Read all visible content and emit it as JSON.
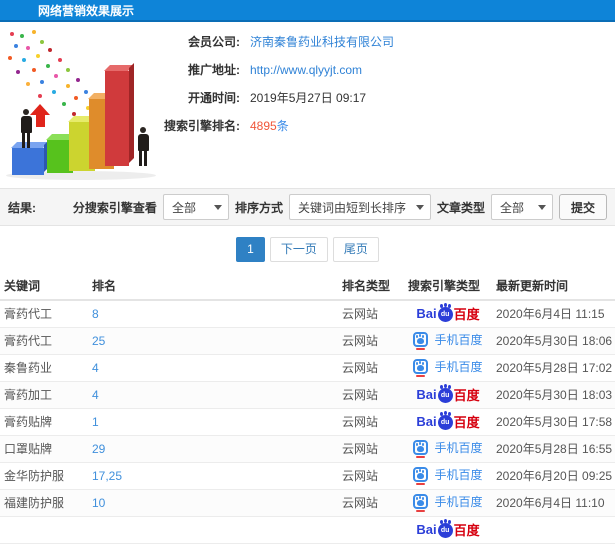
{
  "header": {
    "title": "网络营销效果展示"
  },
  "info": {
    "member_label": "会员公司:",
    "member_value": "济南秦鲁药业科技有限公司",
    "url_label": "推广地址:",
    "url_value": "http://www.qlyyjt.com",
    "open_label": "开通时间:",
    "open_value": "2019年5月27日 09:17",
    "rank_label": "搜索引擎排名:",
    "rank_value": "4895",
    "rank_suffix": "条"
  },
  "filters": {
    "result_label": "结果:",
    "engine_label": "分搜索引擎查看",
    "engine_value": "全部",
    "sort_label": "排序方式",
    "sort_value": "关键词由短到长排序",
    "article_label": "文章类型",
    "article_value": "全部",
    "submit_label": "提交"
  },
  "pagination": {
    "current": "1",
    "next": "下一页",
    "last": "尾页"
  },
  "table": {
    "headers": [
      "关键词",
      "排名",
      "排名类型",
      "搜索引擎类型",
      "最新更新时间"
    ],
    "logos": {
      "baidu_bai": "Bai",
      "baidu_du": "du",
      "baidu_cn": "百度",
      "mobile_label": "手机百度"
    },
    "rows": [
      {
        "keyword": "膏药代工",
        "rank": "8",
        "rank_type": "云网站",
        "engine": "baidu",
        "time": "2020年6月4日 11:15"
      },
      {
        "keyword": "膏药代工",
        "rank": "25",
        "rank_type": "云网站",
        "engine": "mobile",
        "time": "2020年5月30日 18:06"
      },
      {
        "keyword": "秦鲁药业",
        "rank": "4",
        "rank_type": "云网站",
        "engine": "mobile",
        "time": "2020年5月28日 17:02"
      },
      {
        "keyword": "膏药加工",
        "rank": "4",
        "rank_type": "云网站",
        "engine": "baidu",
        "time": "2020年5月30日 18:03"
      },
      {
        "keyword": "膏药贴牌",
        "rank": "1",
        "rank_type": "云网站",
        "engine": "baidu",
        "time": "2020年5月30日 17:58"
      },
      {
        "keyword": "口罩贴牌",
        "rank": "29",
        "rank_type": "云网站",
        "engine": "mobile",
        "time": "2020年5月28日 16:55"
      },
      {
        "keyword": "金华防护服",
        "rank": "17,25",
        "rank_type": "云网站",
        "engine": "mobile",
        "time": "2020年6月20日 09:25"
      },
      {
        "keyword": "福建防护服",
        "rank": "10",
        "rank_type": "云网站",
        "engine": "mobile",
        "time": "2020年6月4日 11:10"
      },
      {
        "keyword": "",
        "rank": "",
        "rank_type": "",
        "engine": "baidu",
        "time": ""
      }
    ]
  },
  "colors": {
    "topbar_blue": "#0e84d8",
    "link_blue": "#2f82d6",
    "rank_link_blue": "#4090dc",
    "highlight_red": "#f0563a",
    "baidu_blue": "#2b3ed8",
    "baidu_red": "#d6000f",
    "mobile_baidu_blue": "#3a8be8",
    "pagination_active": "#2f81c4",
    "filter_bar_bg": "#f5f5f5"
  }
}
